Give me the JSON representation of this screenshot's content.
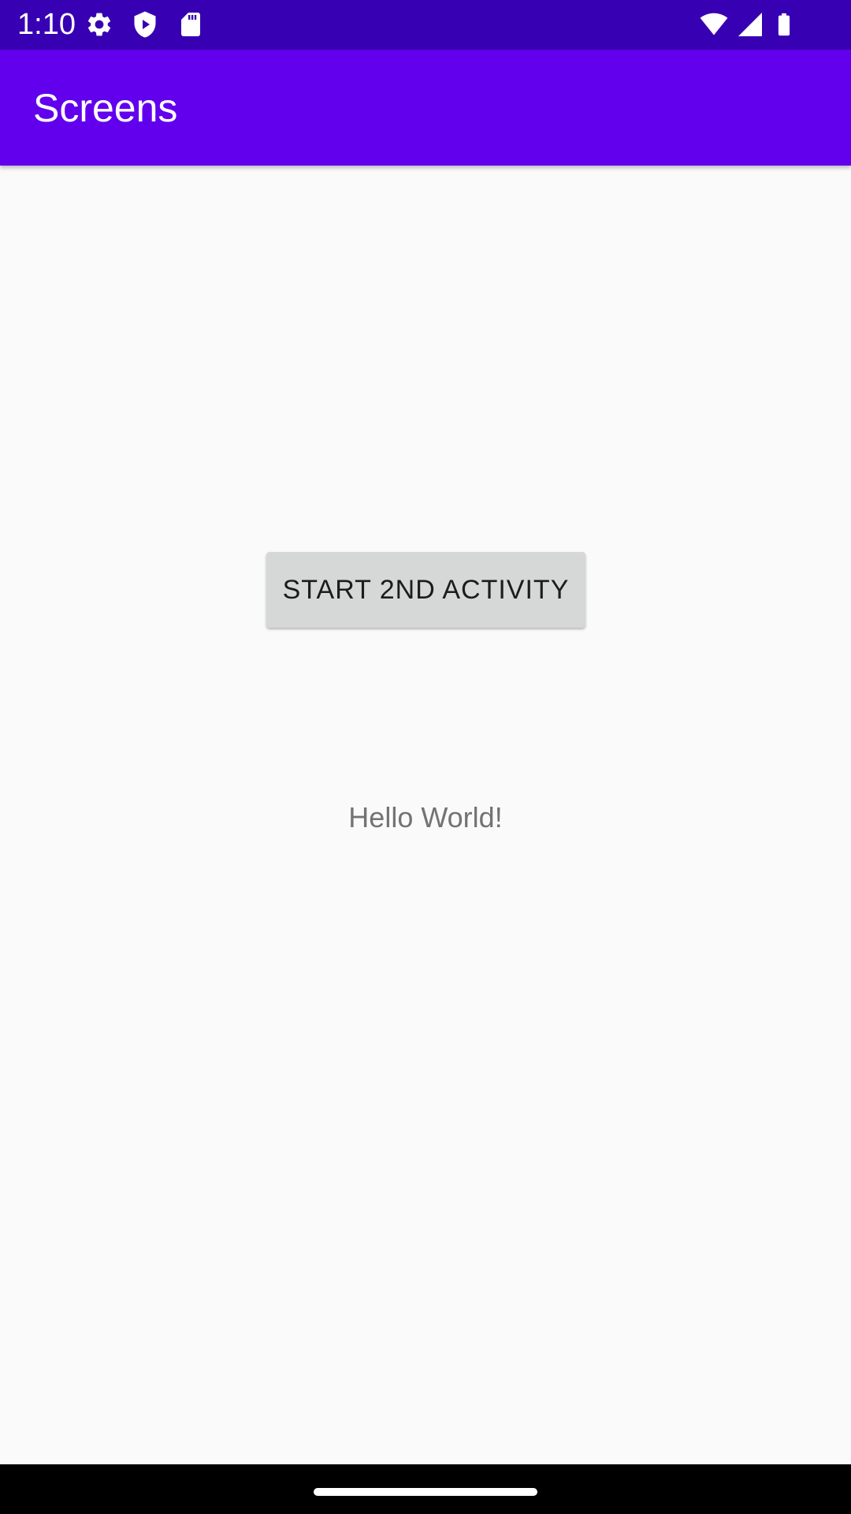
{
  "status_bar": {
    "time": "1:10",
    "icons": [
      "gear-icon",
      "shield-play-icon",
      "sd-card-icon",
      "wifi-icon",
      "cell-signal-icon",
      "battery-icon"
    ],
    "color": "#3700b3"
  },
  "app_bar": {
    "title": "Screens",
    "color": "#6200ee"
  },
  "main": {
    "start_button_label": "START 2ND ACTIVITY",
    "hello_text": "Hello World!"
  },
  "nav_bar": {
    "icons": [
      "home-handle"
    ],
    "color": "#000000"
  }
}
